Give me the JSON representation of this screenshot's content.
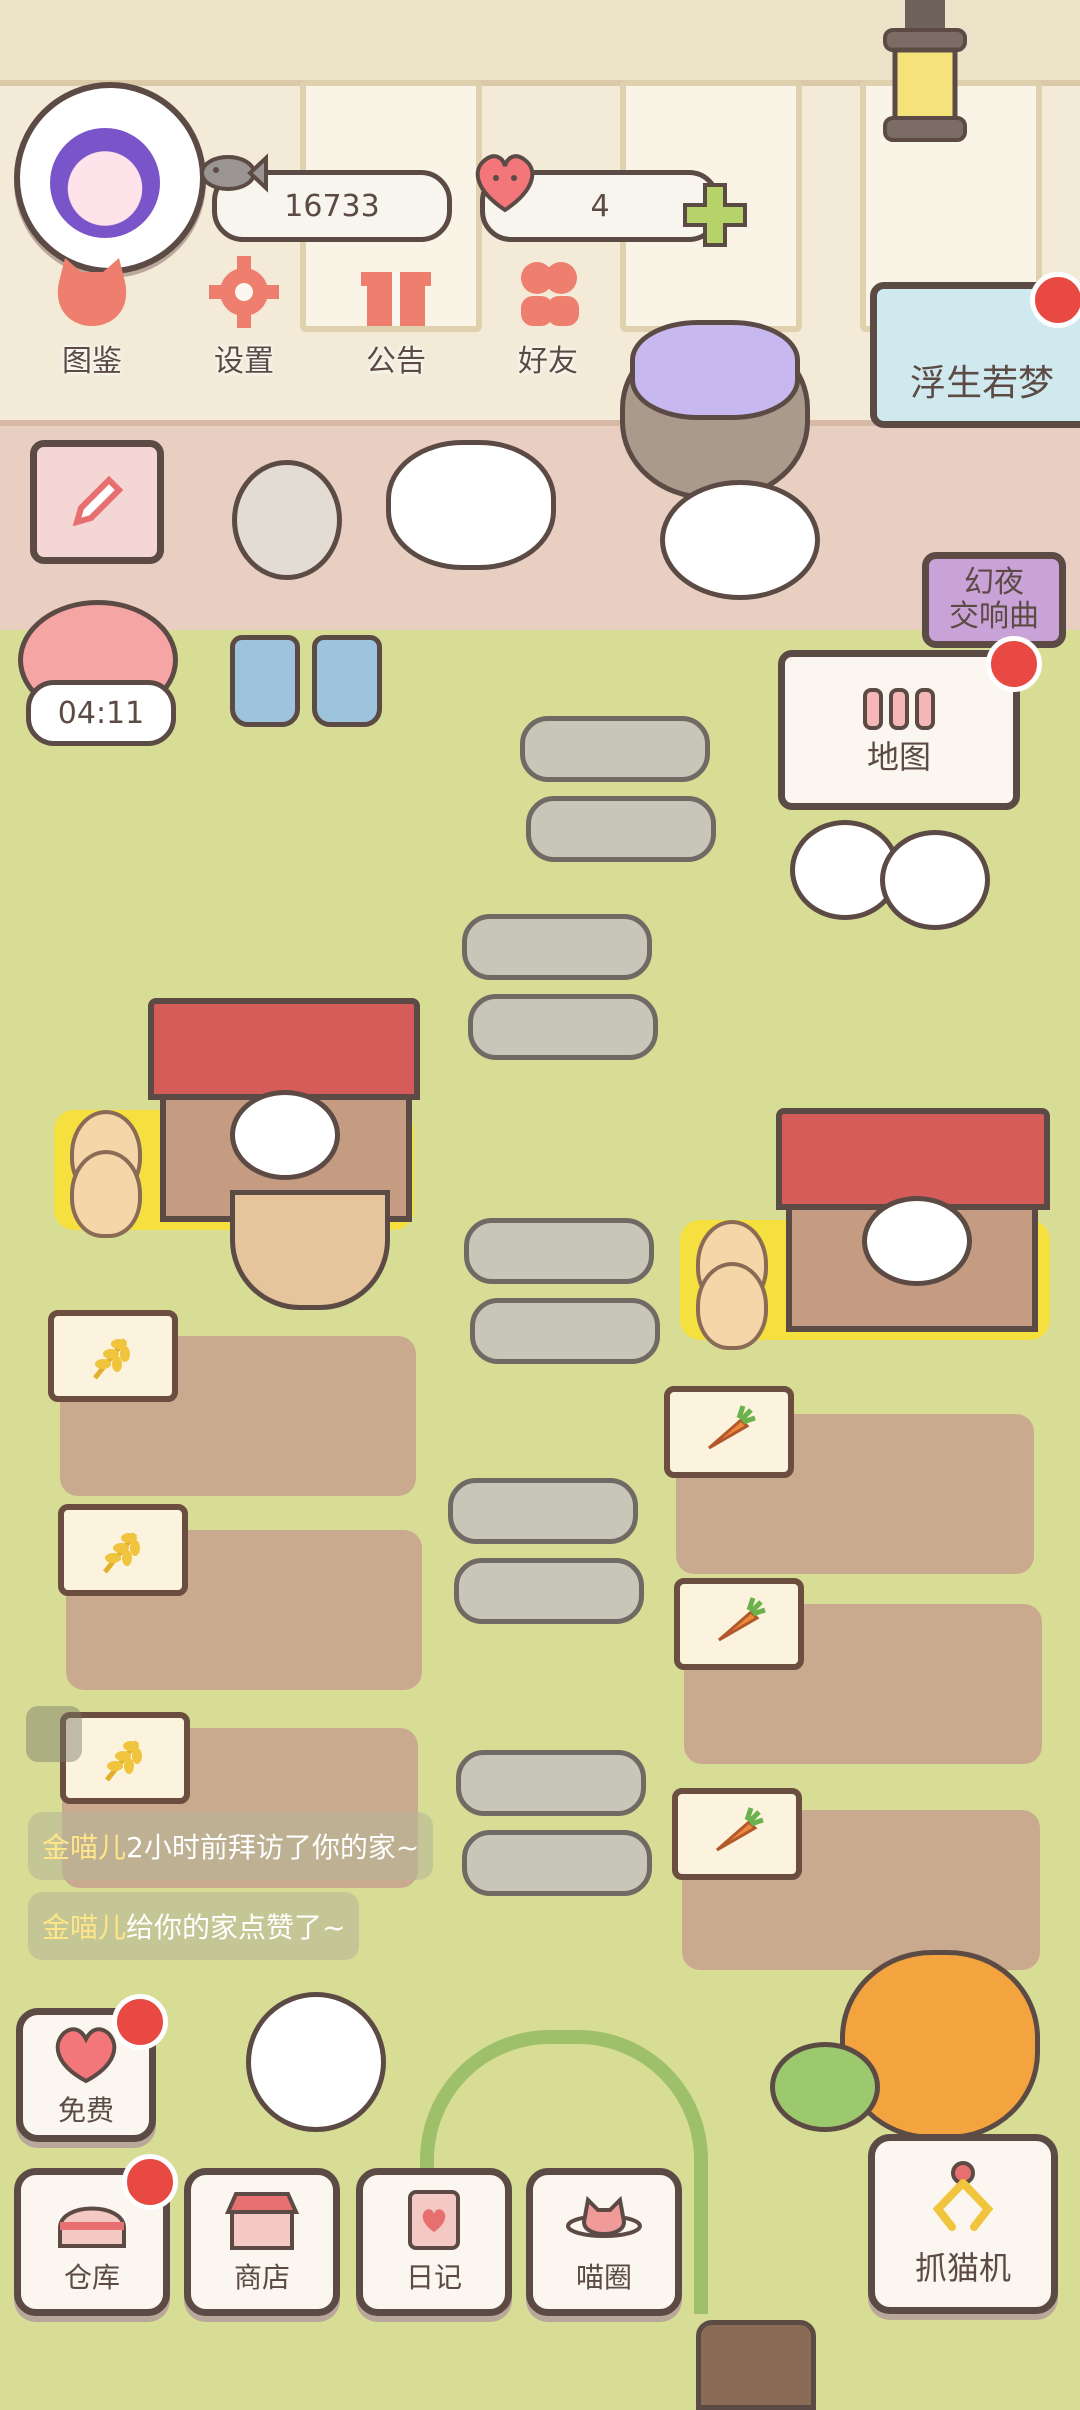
{
  "hud": {
    "fish_coins": "16733",
    "hearts": "4"
  },
  "top_menu": [
    {
      "label": "图鉴",
      "icon": "cat-head-icon"
    },
    {
      "label": "设置",
      "icon": "gear-icon"
    },
    {
      "label": "公告",
      "icon": "gift-icon"
    },
    {
      "label": "好友",
      "icon": "friends-icon"
    }
  ],
  "event_banner": {
    "label": "浮生若梦"
  },
  "event_side": {
    "label_line1": "幻夜",
    "label_line2": "交响曲"
  },
  "timer": "04:11",
  "map_button": {
    "label": "地图"
  },
  "chat": [
    {
      "name": "金喵儿",
      "text": "2小时前拜访了你的家~"
    },
    {
      "name": "金喵儿",
      "text": "给你的家点赞了~"
    }
  ],
  "free_button": {
    "label": "免费"
  },
  "bottom_menu": [
    {
      "label": "仓库",
      "icon": "warehouse-icon",
      "badge": true
    },
    {
      "label": "商店",
      "icon": "shop-icon",
      "badge": false
    },
    {
      "label": "日记",
      "icon": "diary-icon",
      "badge": false
    },
    {
      "label": "喵圈",
      "icon": "planet-cat-icon",
      "badge": false
    }
  ],
  "claw_machine": {
    "label": "抓猫机"
  },
  "colors": {
    "outline": "#5c4a45",
    "badge_red": "#e84a43",
    "grass": "#d8dd96",
    "roof_red": "#d65c5a",
    "chat_name": "#ffe58a"
  }
}
